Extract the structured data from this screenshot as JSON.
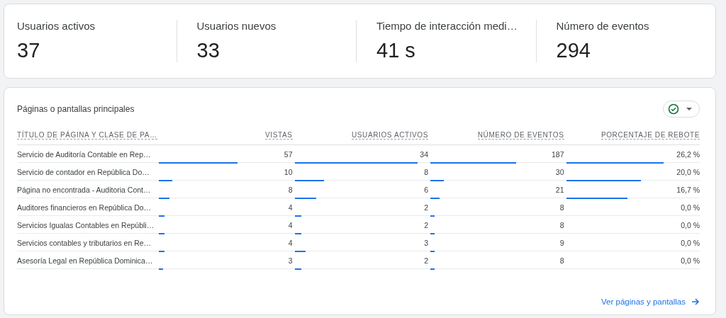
{
  "metrics": [
    {
      "label": "Usuarios activos",
      "value": "37"
    },
    {
      "label": "Usuarios nuevos",
      "value": "33"
    },
    {
      "label": "Tiempo de interacción medi…",
      "value": "41 s"
    },
    {
      "label": "Número de eventos",
      "value": "294"
    }
  ],
  "table_card": {
    "title": "Páginas o pantallas principales",
    "columns": [
      "TÍTULO DE PÁGINA Y CLASE DE PA…",
      "VISTAS",
      "USUARIOS ACTIVOS",
      "NÚMERO DE EVENTOS",
      "PORCENTAJE DE REBOTE"
    ],
    "rows": [
      {
        "cells": [
          {
            "value": "Servicio de Auditoría Contable en Rep…"
          },
          {
            "value": "57",
            "level": 0.59
          },
          {
            "value": "34",
            "level": 0.92
          },
          {
            "value": "187",
            "level": 0.64
          },
          {
            "value": "26,2 %",
            "level": 0.73
          }
        ]
      },
      {
        "cells": [
          {
            "value": "Servicio de contador en República Do…"
          },
          {
            "value": "10",
            "level": 0.1
          },
          {
            "value": "8",
            "level": 0.22
          },
          {
            "value": "30",
            "level": 0.1
          },
          {
            "value": "20,0 %",
            "level": 0.56
          }
        ]
      },
      {
        "cells": [
          {
            "value": "Página no encontrada - Auditoria Cont…"
          },
          {
            "value": "8",
            "level": 0.08
          },
          {
            "value": "6",
            "level": 0.16
          },
          {
            "value": "21",
            "level": 0.07
          },
          {
            "value": "16,7 %",
            "level": 0.46
          }
        ]
      },
      {
        "cells": [
          {
            "value": "Auditores financieros en República Do…"
          },
          {
            "value": "4",
            "level": 0.04
          },
          {
            "value": "2",
            "level": 0.05
          },
          {
            "value": "8",
            "level": 0.03
          },
          {
            "value": "0,0 %"
          }
        ]
      },
      {
        "cells": [
          {
            "value": "Servicios Igualas Contables en Repúbli…"
          },
          {
            "value": "4",
            "level": 0.04
          },
          {
            "value": "2",
            "level": 0.05
          },
          {
            "value": "8",
            "level": 0.03
          },
          {
            "value": "0,0 %"
          }
        ]
      },
      {
        "cells": [
          {
            "value": "Servicios contables y tributarios en Re…"
          },
          {
            "value": "4",
            "level": 0.04
          },
          {
            "value": "3",
            "level": 0.08
          },
          {
            "value": "9",
            "level": 0.03
          },
          {
            "value": "0,0 %"
          }
        ]
      },
      {
        "cells": [
          {
            "value": "Asesoría Legal en República Dominica…"
          },
          {
            "value": "3",
            "level": 0.03
          },
          {
            "value": "2",
            "level": 0.05
          },
          {
            "value": "8",
            "level": 0.03
          },
          {
            "value": "0,0 %"
          }
        ]
      }
    ],
    "link": "Ver páginas y pantallas"
  }
}
